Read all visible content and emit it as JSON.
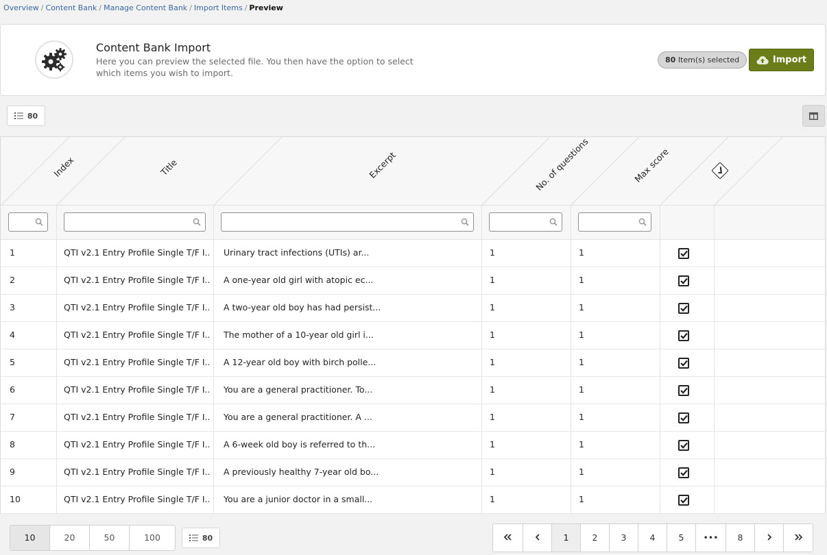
{
  "breadcrumb": {
    "items": [
      "Overview",
      "Content Bank",
      "Manage Content Bank",
      "Import Items"
    ],
    "current": "Preview"
  },
  "header": {
    "title": "Content Bank Import",
    "description": "Here you can preview the selected file. You then have the option to select which items you wish to import.",
    "selected_count": "80",
    "selected_label": "Item(s) selected",
    "import_label": "Import",
    "icon": "gears-icon"
  },
  "toolbar": {
    "count": "80",
    "list_icon": "list-icon",
    "columns_icon": "columns-toggle-icon"
  },
  "table": {
    "headers": [
      "Index",
      "Title",
      "Excerpt",
      "No. of questions",
      "Max score",
      "select-all-checkbox-icon"
    ],
    "rows": [
      {
        "index": "1",
        "title": "QTI v2.1 Entry Profile Single T/F I...",
        "excerpt": "Urinary tract infections (UTIs) ar...",
        "questions": "1",
        "max_score": "1",
        "checked": true
      },
      {
        "index": "2",
        "title": "QTI v2.1 Entry Profile Single T/F I...",
        "excerpt": "A one-year old girl with atopic ec...",
        "questions": "1",
        "max_score": "1",
        "checked": true
      },
      {
        "index": "3",
        "title": "QTI v2.1 Entry Profile Single T/F I...",
        "excerpt": "A two-year old boy has had persist...",
        "questions": "1",
        "max_score": "1",
        "checked": true
      },
      {
        "index": "4",
        "title": "QTI v2.1 Entry Profile Single T/F I...",
        "excerpt": "The mother of a 10-year old girl i...",
        "questions": "1",
        "max_score": "1",
        "checked": true
      },
      {
        "index": "5",
        "title": "QTI v2.1 Entry Profile Single T/F I...",
        "excerpt": "A 12-year old boy with birch polle...",
        "questions": "1",
        "max_score": "1",
        "checked": true
      },
      {
        "index": "6",
        "title": "QTI v2.1 Entry Profile Single T/F I...",
        "excerpt": "You are a general practitioner. To...",
        "questions": "1",
        "max_score": "1",
        "checked": true
      },
      {
        "index": "7",
        "title": "QTI v2.1 Entry Profile Single T/F I...",
        "excerpt": "You are a general practitioner. A ...",
        "questions": "1",
        "max_score": "1",
        "checked": true
      },
      {
        "index": "8",
        "title": "QTI v2.1 Entry Profile Single T/F I...",
        "excerpt": "A 6-week old boy is referred to th...",
        "questions": "1",
        "max_score": "1",
        "checked": true
      },
      {
        "index": "9",
        "title": "QTI v2.1 Entry Profile Single T/F I...",
        "excerpt": "A previously healthy 7-year old bo...",
        "questions": "1",
        "max_score": "1",
        "checked": true
      },
      {
        "index": "10",
        "title": "QTI v2.1 Entry Profile Single T/F I...",
        "excerpt": "You are a junior doctor in a small...",
        "questions": "1",
        "max_score": "1",
        "checked": true
      }
    ]
  },
  "footer": {
    "page_sizes": [
      "10",
      "20",
      "50",
      "100"
    ],
    "active_page_size": "10",
    "count": "80",
    "pages": [
      "1",
      "2",
      "3",
      "4",
      "5",
      "•••",
      "8"
    ],
    "active_page": "1",
    "first_icon": "double-chevron-left-icon",
    "prev_icon": "chevron-left-icon",
    "next_icon": "chevron-right-icon",
    "last_icon": "double-chevron-right-icon"
  },
  "colors": {
    "import_button": "#6b7d18",
    "link": "#3b67a2",
    "background": "#f2f2f2"
  }
}
